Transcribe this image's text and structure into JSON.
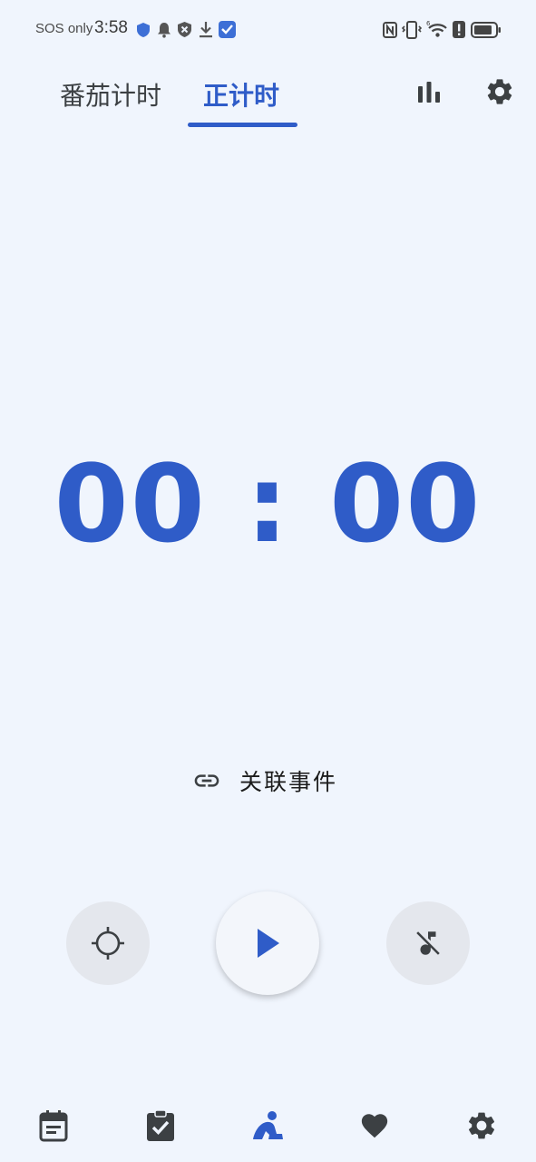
{
  "status_bar": {
    "carrier": "SOS only",
    "time": "3:58",
    "left_icons": [
      "shield-icon",
      "bell-icon",
      "blocked-icon",
      "download-icon",
      "app-badge-icon"
    ],
    "right_icons": [
      "nfc-icon",
      "vibrate-icon",
      "wifi-6-icon",
      "battery-alert-icon",
      "battery-icon"
    ]
  },
  "header": {
    "tabs": [
      {
        "label": "番茄计时",
        "active": false
      },
      {
        "label": "正计时",
        "active": true
      }
    ],
    "actions": [
      "stats-icon",
      "gear-icon"
    ]
  },
  "timer": {
    "display": "00 : 00"
  },
  "link_event": {
    "label": "关联事件",
    "icon": "link-icon"
  },
  "controls": {
    "focus": "focus-target-icon",
    "play": "play-icon",
    "sound": "music-off-icon"
  },
  "bottom_nav": {
    "items": [
      {
        "icon": "calendar-icon",
        "active": false
      },
      {
        "icon": "checklist-icon",
        "active": false
      },
      {
        "icon": "focus-person-icon",
        "active": true
      },
      {
        "icon": "heart-icon",
        "active": false
      },
      {
        "icon": "settings-icon",
        "active": false
      }
    ]
  },
  "colors": {
    "accent": "#2f5cc8",
    "background": "#f0f5fd",
    "icon": "#3c4043"
  }
}
